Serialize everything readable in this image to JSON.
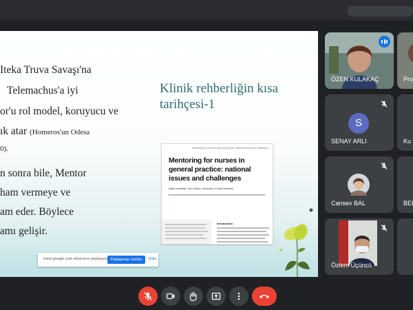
{
  "presentation": {
    "body_lines": [
      {
        "text": "Iteka Truva Savaşı'na",
        "small": ""
      },
      {
        "text": "Telemachus'a  iyi",
        "small": ""
      },
      {
        "text": "or'u rol model, koruyucu ve",
        "small": ""
      },
      {
        "text": "ık atar",
        "small": "(Homeros'un Odesa"
      },
      {
        "text": "",
        "small": "0)."
      },
      {
        "text": "n sonra bile, Mentor",
        "small": ""
      },
      {
        "text": "ham vermeye ve",
        "small": ""
      },
      {
        "text": "am eder. Böylece",
        "small": ""
      },
      {
        "text": "amı gelişir.",
        "small": ""
      }
    ],
    "title": "Klinik rehberliğin kısa tarihçesi-1",
    "paper": {
      "header": "Mentoring for nurses in general practice: national issues and challenges",
      "title": "Mentoring for nurses in general practice: national issues and challenges",
      "authors": "Marie Heartfield, Terri Gibson, University of South Australia",
      "intro": "Introduction"
    }
  },
  "share_bar": {
    "text": "meet.google.com ekranınızı paylaşıyor.",
    "stop_label": "Paylaşmayı durdur",
    "hide_label": "Gizle"
  },
  "participants": [
    {
      "name": "ÖZEN KULAKAÇ",
      "type": "video",
      "speaking": true
    },
    {
      "name": "Pro",
      "type": "video",
      "speaking": false
    },
    {
      "name": "SENAY ARLI",
      "type": "initial",
      "initial": "S",
      "muted": true
    },
    {
      "name": "Ku",
      "type": "video",
      "muted": true
    },
    {
      "name": "Cansev BAL",
      "type": "photo",
      "muted": true
    },
    {
      "name": "BEL",
      "type": "video",
      "muted": true
    },
    {
      "name": "Özlem Üçüncü",
      "type": "video",
      "muted": true
    }
  ],
  "colors": {
    "accent": "#1a73e8",
    "danger": "#ea4335",
    "title_teal": "#2f6b6e",
    "tile_bg": "#3c4043"
  },
  "controls": [
    {
      "name": "mic-off-icon"
    },
    {
      "name": "camera-icon"
    },
    {
      "name": "raise-hand-icon"
    },
    {
      "name": "present-icon"
    },
    {
      "name": "more-vert-icon"
    },
    {
      "name": "end-call-icon"
    }
  ]
}
